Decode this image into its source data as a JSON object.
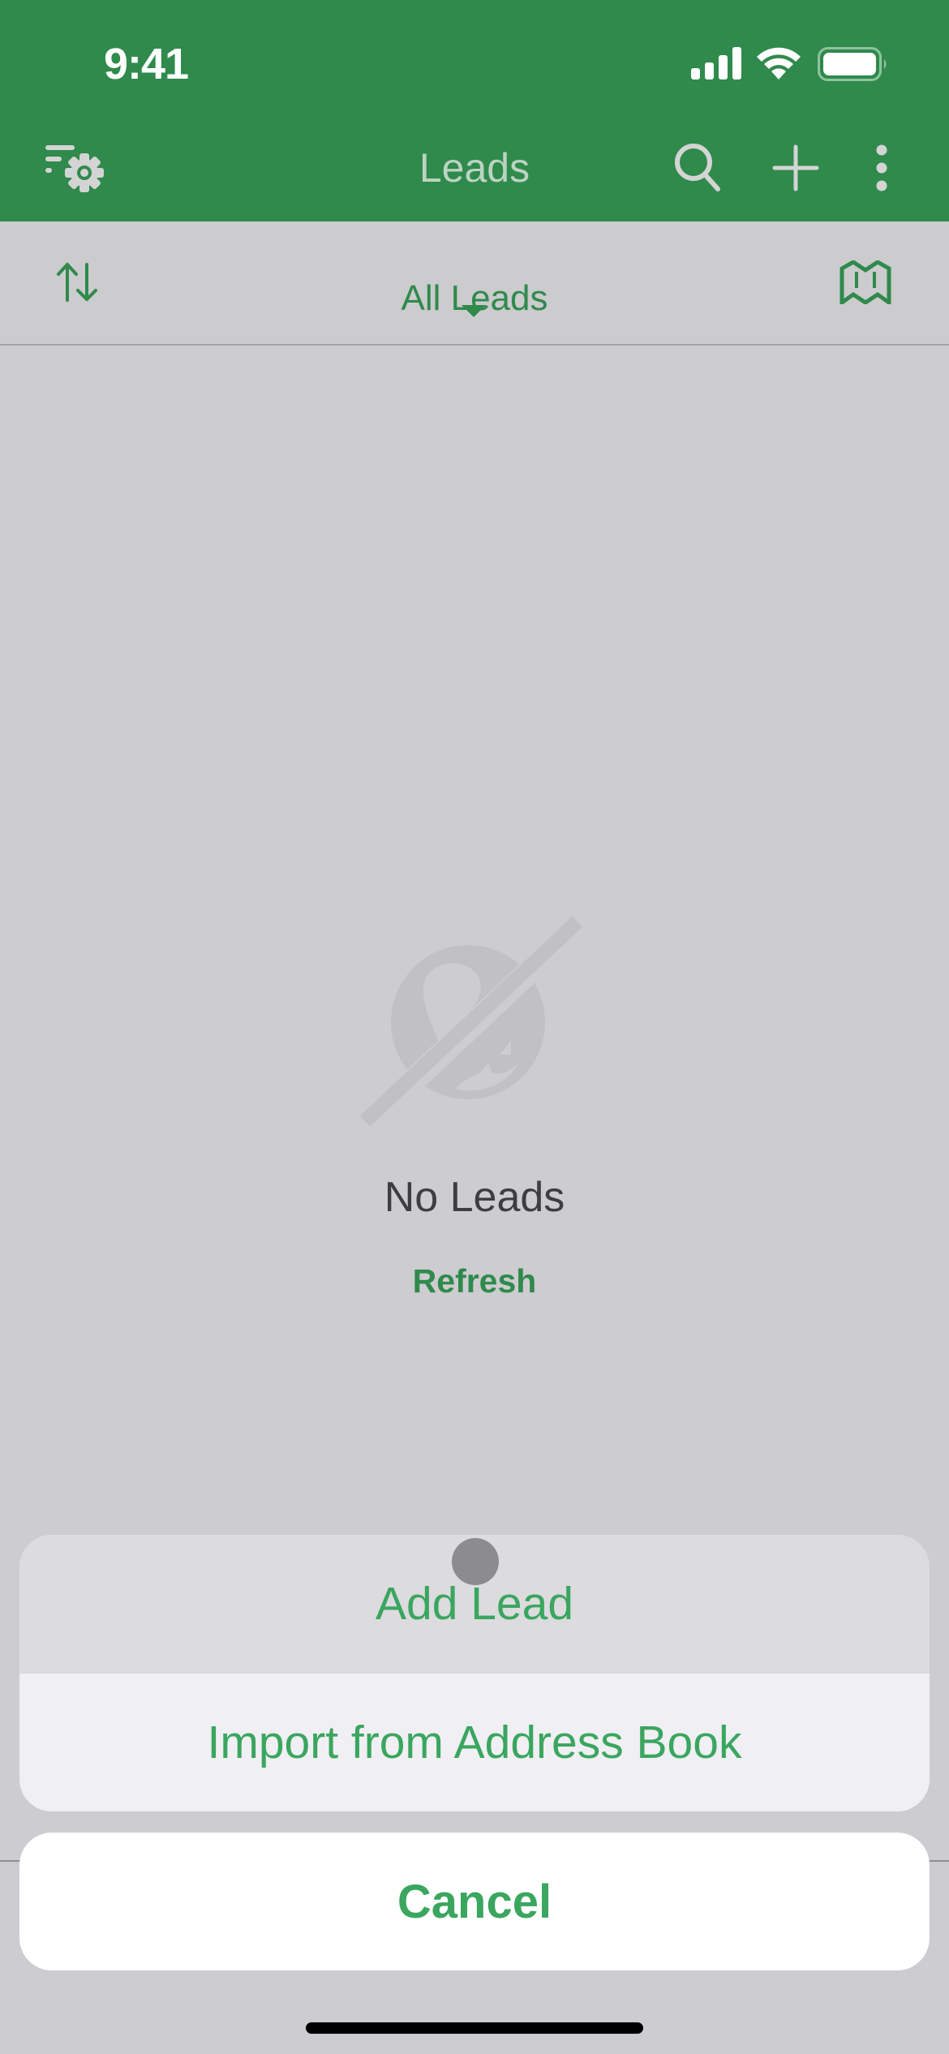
{
  "status_bar": {
    "time": "9:41",
    "icons": [
      "cellular-signal-icon",
      "wifi-icon",
      "battery-icon"
    ]
  },
  "nav": {
    "title": "Leads",
    "left_icon": "filter-settings-icon",
    "right_icons": [
      "search-icon",
      "plus-icon",
      "more-vertical-icon"
    ]
  },
  "filter_bar": {
    "sort_icon": "sort-icon",
    "selected_filter": "All Leads",
    "dropdown_icon": "caret-down-icon",
    "map_icon": "map-icon"
  },
  "empty_state": {
    "icon": "no-leads-icon",
    "message": "No Leads",
    "action_label": "Refresh"
  },
  "action_sheet": {
    "options": [
      {
        "label": "Add Lead",
        "highlighted": true
      },
      {
        "label": "Import from Address Book",
        "highlighted": false
      }
    ],
    "cancel_label": "Cancel"
  },
  "colors": {
    "brand_green": "#2f8a4c",
    "action_green": "#3aa65f",
    "nav_icon": "#d4d4d4",
    "dimmed_background": "#cdccd0"
  }
}
